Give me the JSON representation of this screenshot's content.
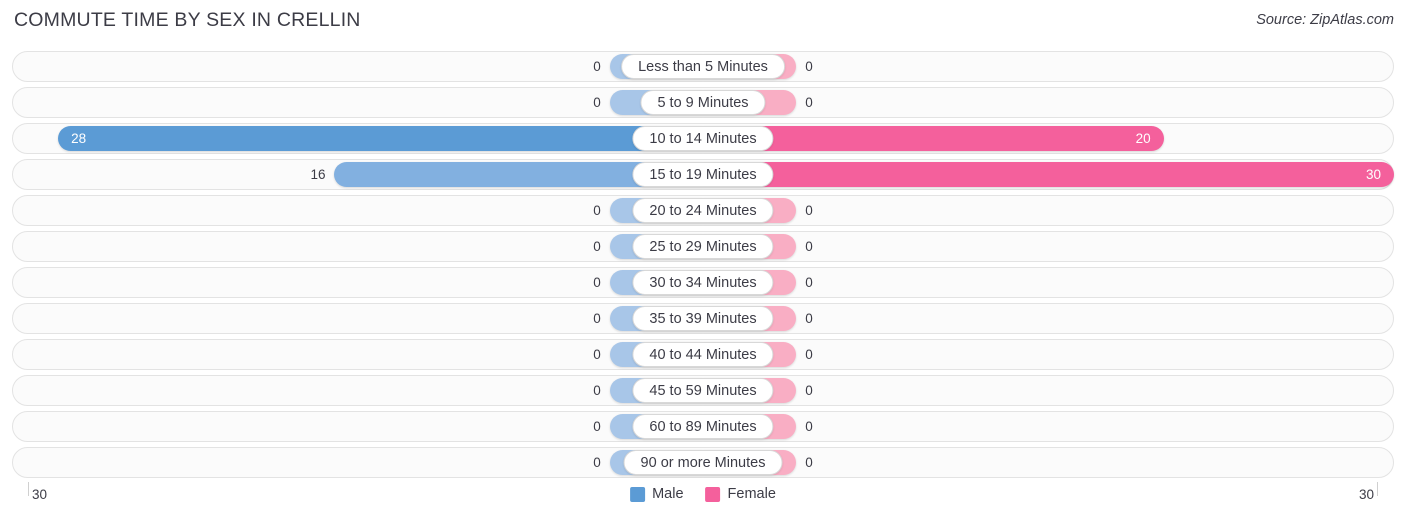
{
  "header": {
    "title": "COMMUTE TIME BY SEX IN CRELLIN",
    "source": "Source: ZipAtlas.com"
  },
  "legend": {
    "male_label": "Male",
    "female_label": "Female",
    "male_color": "#5b9bd5",
    "female_color": "#f4609c"
  },
  "axis": {
    "left_label": "30",
    "right_label": "30"
  },
  "colors": {
    "male_strong": "#5b9bd5",
    "male_light": "#a8c6e8",
    "female_strong": "#f4609c",
    "female_light": "#f9aec4",
    "track_fill": "#fbfbfb",
    "track_border": "#e3e3e3",
    "text": "#3c3c46"
  },
  "chart_data": {
    "type": "bar",
    "subtype": "diverging-bar",
    "title": "COMMUTE TIME BY SEX IN CRELLIN",
    "xlabel": "",
    "ylabel": "",
    "xlim": [
      30,
      30
    ],
    "axis_max": 30,
    "grid": false,
    "legend_position": "bottom-center",
    "categories": [
      "Less than 5 Minutes",
      "5 to 9 Minutes",
      "10 to 14 Minutes",
      "15 to 19 Minutes",
      "20 to 24 Minutes",
      "25 to 29 Minutes",
      "30 to 34 Minutes",
      "35 to 39 Minutes",
      "40 to 44 Minutes",
      "45 to 59 Minutes",
      "60 to 89 Minutes",
      "90 or more Minutes"
    ],
    "series": [
      {
        "name": "Male",
        "color": "#5b9bd5",
        "direction": "left",
        "values": [
          0,
          0,
          28,
          16,
          0,
          0,
          0,
          0,
          0,
          0,
          0,
          0
        ]
      },
      {
        "name": "Female",
        "color": "#f4609c",
        "direction": "right",
        "values": [
          0,
          0,
          20,
          30,
          0,
          0,
          0,
          0,
          0,
          0,
          0,
          0
        ]
      }
    ]
  },
  "rows": [
    {
      "label": "Less than 5 Minutes",
      "male": 0,
      "male_text": "0",
      "female": 0,
      "female_text": "0"
    },
    {
      "label": "5 to 9 Minutes",
      "male": 0,
      "male_text": "0",
      "female": 0,
      "female_text": "0"
    },
    {
      "label": "10 to 14 Minutes",
      "male": 28,
      "male_text": "28",
      "female": 20,
      "female_text": "20"
    },
    {
      "label": "15 to 19 Minutes",
      "male": 16,
      "male_text": "16",
      "female": 30,
      "female_text": "30"
    },
    {
      "label": "20 to 24 Minutes",
      "male": 0,
      "male_text": "0",
      "female": 0,
      "female_text": "0"
    },
    {
      "label": "25 to 29 Minutes",
      "male": 0,
      "male_text": "0",
      "female": 0,
      "female_text": "0"
    },
    {
      "label": "30 to 34 Minutes",
      "male": 0,
      "male_text": "0",
      "female": 0,
      "female_text": "0"
    },
    {
      "label": "35 to 39 Minutes",
      "male": 0,
      "male_text": "0",
      "female": 0,
      "female_text": "0"
    },
    {
      "label": "40 to 44 Minutes",
      "male": 0,
      "male_text": "0",
      "female": 0,
      "female_text": "0"
    },
    {
      "label": "45 to 59 Minutes",
      "male": 0,
      "male_text": "0",
      "female": 0,
      "female_text": "0"
    },
    {
      "label": "60 to 89 Minutes",
      "male": 0,
      "male_text": "0",
      "female": 0,
      "female_text": "0"
    },
    {
      "label": "90 or more Minutes",
      "male": 0,
      "male_text": "0",
      "female": 0,
      "female_text": "0"
    }
  ]
}
